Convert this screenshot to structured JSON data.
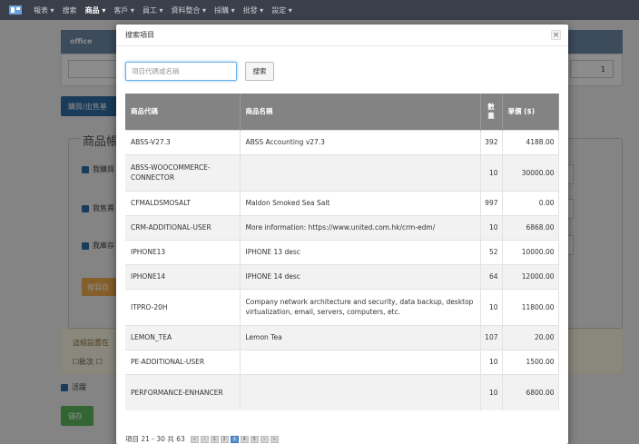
{
  "nav": {
    "items": [
      "報表 ▾",
      "搜索",
      "商品 ▾",
      "客戶 ▾",
      "員工 ▾",
      "資料整合 ▾",
      "採購 ▾",
      "批發 ▾",
      "設定 ▾"
    ],
    "active_index": 2
  },
  "background": {
    "office_title": "office",
    "qty_value": "1",
    "buy_sell_button": "購買/出售基",
    "section_legend": "商品帳",
    "check_buy": "我購買",
    "check_sell": "我售賣",
    "check_stock": "我庫存",
    "copy_button": "複製自",
    "note_text": "這組設置在",
    "note_opts": "☐批次 ☐",
    "active_label": "活躍",
    "save_button": "儲存"
  },
  "modal": {
    "title": "搜索項目",
    "close_label": "×",
    "search_placeholder": "項目代碼或名稱",
    "search_button": "搜索",
    "columns": {
      "code": "商品代碼",
      "name": "商品名稱",
      "qty": "數量",
      "price": "單價 ($)"
    },
    "rows": [
      {
        "code": "ABSS-V27.3",
        "name": "ABSS Accounting v27.3",
        "qty": "392",
        "price": "4188.00"
      },
      {
        "code": "ABSS-WOOCOMMERCE-CONNECTOR",
        "name": "",
        "qty": "10",
        "price": "30000.00"
      },
      {
        "code": "CFMALDSMOSALT",
        "name": "Maldon Smoked Sea Salt",
        "qty": "997",
        "price": "0.00"
      },
      {
        "code": "CRM-ADDITIONAL-USER",
        "name": "More information: https://www.united.com.hk/crm-edm/",
        "qty": "10",
        "price": "6868.00"
      },
      {
        "code": "IPHONE13",
        "name": "IPHONE 13 desc",
        "qty": "52",
        "price": "10000.00"
      },
      {
        "code": "IPHONE14",
        "name": "IPHONE 14 desc",
        "qty": "64",
        "price": "12000.00"
      },
      {
        "code": "ITPRO-20H",
        "name": "Company network architecture and security, data backup, desktop virtualization, email, servers, computers, etc.",
        "qty": "10",
        "price": "11800.00"
      },
      {
        "code": "LEMON_TEA",
        "name": "Lemon Tea",
        "qty": "107",
        "price": "20.00"
      },
      {
        "code": "PE-ADDITIONAL-USER",
        "name": "",
        "qty": "10",
        "price": "1500.00"
      },
      {
        "code": "PERFORMANCE-ENHANCER",
        "name": "",
        "qty": "10",
        "price": "6800.00"
      }
    ],
    "pager_text": "項目 21 - 30 共 63",
    "pages": [
      "«",
      "‹",
      "1",
      "2",
      "3",
      "4",
      "5",
      "›",
      "»"
    ],
    "current_page": "3"
  },
  "colors": {
    "navbar": "#3a3f4a",
    "table_header": "#838383",
    "primary_button": "#2e6da4",
    "save_button": "#5cb85c"
  }
}
